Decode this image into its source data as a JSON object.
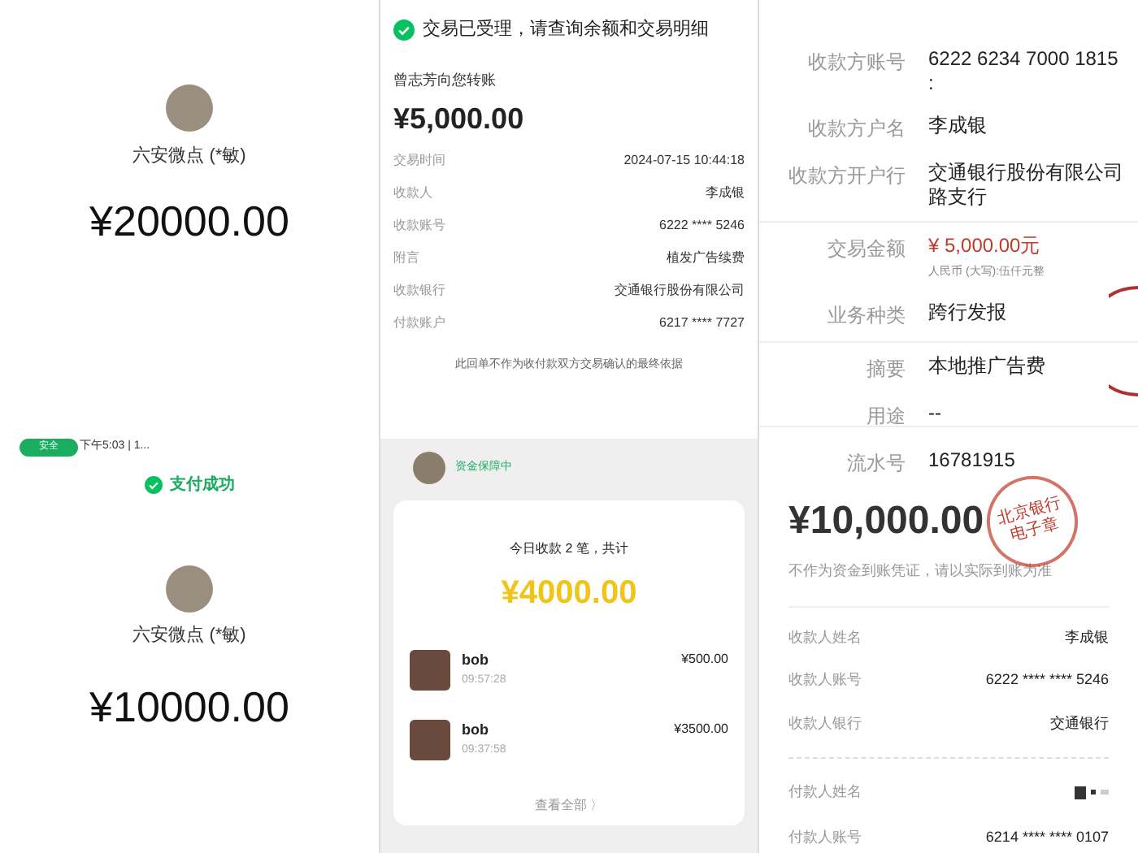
{
  "left_panel": {
    "top_receipt": {
      "payee": "六安微点 (*敏)",
      "amount": "¥20000.00"
    },
    "bottom_receipt": {
      "badge": "安全",
      "status_time": "下午5:03 | 1...",
      "status": "支付成功",
      "payee": "六安微点 (*敏)",
      "amount": "¥10000.00"
    }
  },
  "middle_panel": {
    "bank_receipt": {
      "notice": "交易已受理，请查询余额和交易明细",
      "sender": "曾志芳向您转账",
      "amount": "¥5,000.00",
      "rows": [
        {
          "label": "交易时间",
          "value": "2024-07-15 10:44:18"
        },
        {
          "label": "收款人",
          "value": "李成银"
        },
        {
          "label": "收款账号",
          "value": "6222 **** 5246"
        },
        {
          "label": "附言",
          "value": "植发广告续费"
        },
        {
          "label": "收款银行",
          "value": "交通银行股份有限公司"
        },
        {
          "label": "付款账户",
          "value": "6217 **** 7727"
        }
      ],
      "footnote": "此回单不作为收付款双方交易确认的最终依据"
    },
    "collection_summary": {
      "guarantee": "资金保障中",
      "title": "今日收款 2 笔，共计",
      "total": "¥4000.00",
      "payments": [
        {
          "name": "bob",
          "time": "09:57:28",
          "amount": "¥500.00"
        },
        {
          "name": "bob",
          "time": "09:37:58",
          "amount": "¥3500.00"
        }
      ],
      "view_all": "查看全部 〉"
    }
  },
  "right_panel": {
    "transfer_detail": {
      "groups": [
        [
          {
            "label": "收款方账号",
            "value": "6222 6234 7000 1815 :"
          },
          {
            "label": "收款方户名",
            "value": "李成银"
          },
          {
            "label": "收款方开户行",
            "value": "交通银行股份有限公司路支行"
          }
        ],
        [
          {
            "label": "交易金额",
            "value": "¥ 5,000.00元",
            "note": "人民币 (大写):伍仟元整",
            "kind": "amount"
          },
          {
            "label": "业务种类",
            "value": "跨行发报"
          }
        ],
        [
          {
            "label": "摘要",
            "value": "本地推广告费"
          },
          {
            "label": "用途",
            "value": "--"
          },
          {
            "label": "流水号",
            "value": "16781915"
          }
        ]
      ]
    },
    "transfer_receipt": {
      "amount": "¥10,000.00",
      "stamp": [
        "北京银行",
        "电子章"
      ],
      "disclaimer": "不作为资金到账凭证，请以实际到账为准",
      "payee_rows": [
        {
          "label": "收款人姓名",
          "value": "李成银"
        },
        {
          "label": "收款人账号",
          "value": "6222 **** **** 5246"
        },
        {
          "label": "收款人银行",
          "value": "交通银行"
        }
      ],
      "payer_rows": [
        {
          "label": "付款人姓名",
          "kind": "masked"
        },
        {
          "label": "付款人账号",
          "value": "6214 **** **** 0107"
        }
      ]
    }
  }
}
